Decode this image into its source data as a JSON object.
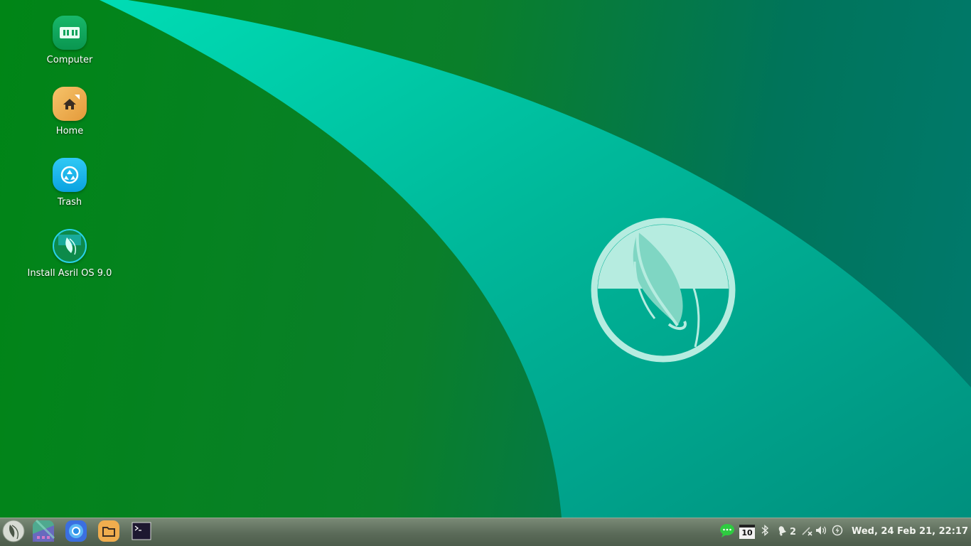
{
  "desktop": {
    "icons": [
      {
        "label": "Computer",
        "icon": "computer-icon"
      },
      {
        "label": "Home",
        "icon": "home-folder-icon"
      },
      {
        "label": "Trash",
        "icon": "trash-icon"
      },
      {
        "label": "Install Asril OS 9.0",
        "icon": "installer-icon"
      }
    ],
    "wallpaper_logo": "asril-leaf-logo"
  },
  "panel": {
    "launchers": [
      "menu-icon",
      "app-grid-icon",
      "browser-icon",
      "file-manager-icon",
      "terminal-icon"
    ],
    "tray": {
      "chat": "chat-bubble-icon",
      "calendar_day": "10",
      "bluetooth": "bluetooth-icon",
      "notification_count": "2",
      "network": "network-disconnected-icon",
      "volume": "volume-icon",
      "power": "power-icon"
    },
    "clock": "Wed, 24 Feb 21, 22:17"
  },
  "colors": {
    "desktop_green": "#008516",
    "swoosh_teal": "#00d3b0",
    "panel": "#6a7a66"
  }
}
